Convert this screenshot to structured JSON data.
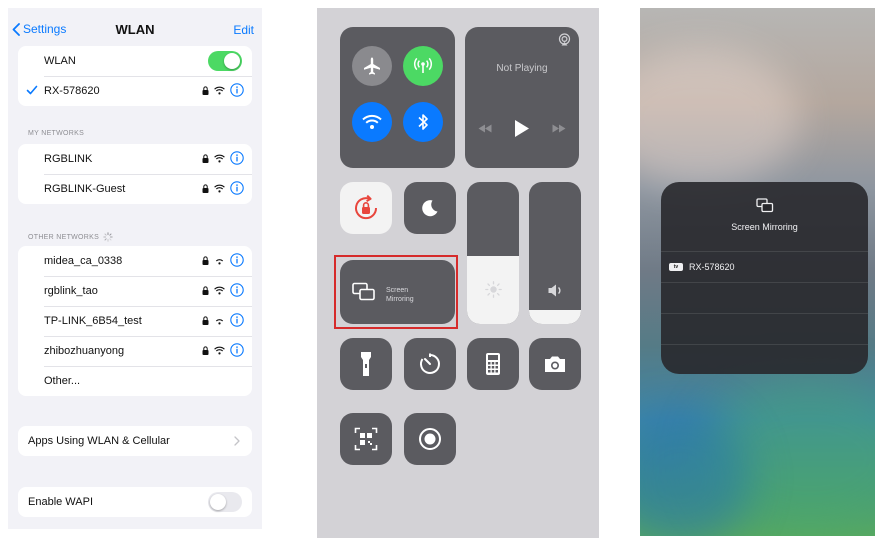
{
  "wlan_settings": {
    "back_label": "Settings",
    "title": "WLAN",
    "edit_label": "Edit",
    "wlan_label": "WLAN",
    "wlan_enabled": true,
    "connected_network": "RX-578620",
    "my_networks_header": "MY NETWORKS",
    "my_networks": [
      "RGBLINK",
      "RGBLINK-Guest"
    ],
    "other_networks_header": "OTHER NETWORKS",
    "other_networks": [
      "midea_ca_0338",
      "rgblink_tao",
      "TP-LINK_6B54_test",
      "zhibozhuanyong"
    ],
    "other_label": "Other...",
    "apps_row_label": "Apps Using WLAN & Cellular",
    "wapi_label": "Enable WAPI",
    "wapi_enabled": false,
    "colors": {
      "accent": "#0a7aff",
      "toggle_on": "#4cd964"
    }
  },
  "control_center": {
    "now_playing_label": "Not Playing",
    "screen_mirroring_label_line1": "Screen",
    "screen_mirroring_label_line2": "Mirroring",
    "brightness_level": 0.48,
    "volume_level": 0.1,
    "highlight_color": "#d62b2b",
    "colors": {
      "airplane": "#8a8a8e",
      "cellular": "#4cd964",
      "wifi": "#0a7aff",
      "bluetooth": "#0a7aff"
    }
  },
  "screen_mirroring": {
    "title": "Screen Mirroring",
    "appletv_badge": "tv",
    "devices": [
      "RX-578620"
    ]
  }
}
